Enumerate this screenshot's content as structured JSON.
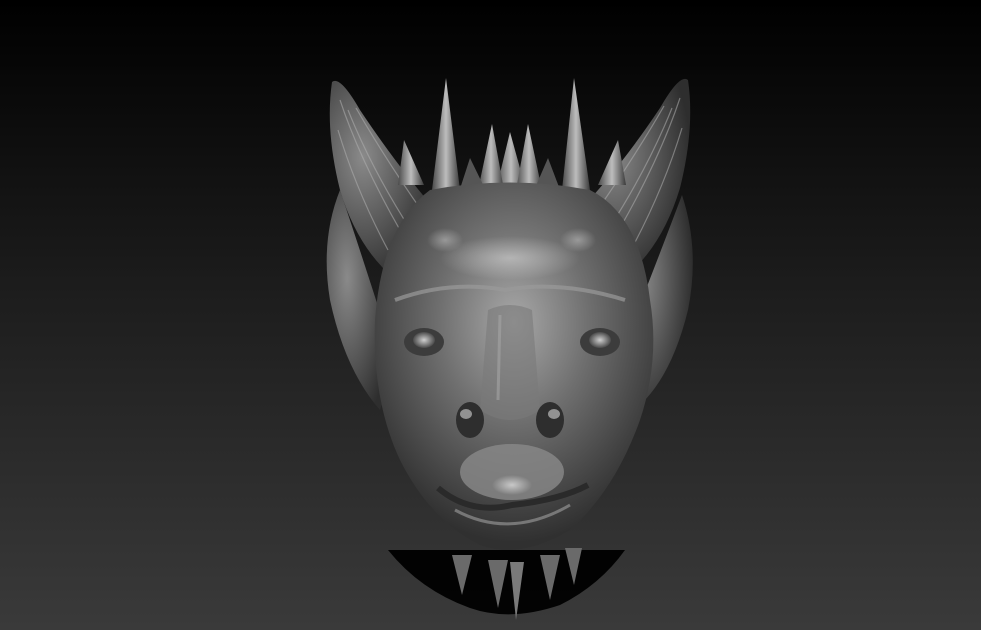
{
  "viewport": {
    "subject": "sculpted-creature-head",
    "colors": {
      "bg_top": "#000000",
      "bg_bottom": "#3a3a3a",
      "material_light": "#bdbdbd",
      "material_mid": "#6e6e6e",
      "material_dark": "#2a2a2a",
      "shadow": "#000000"
    }
  }
}
